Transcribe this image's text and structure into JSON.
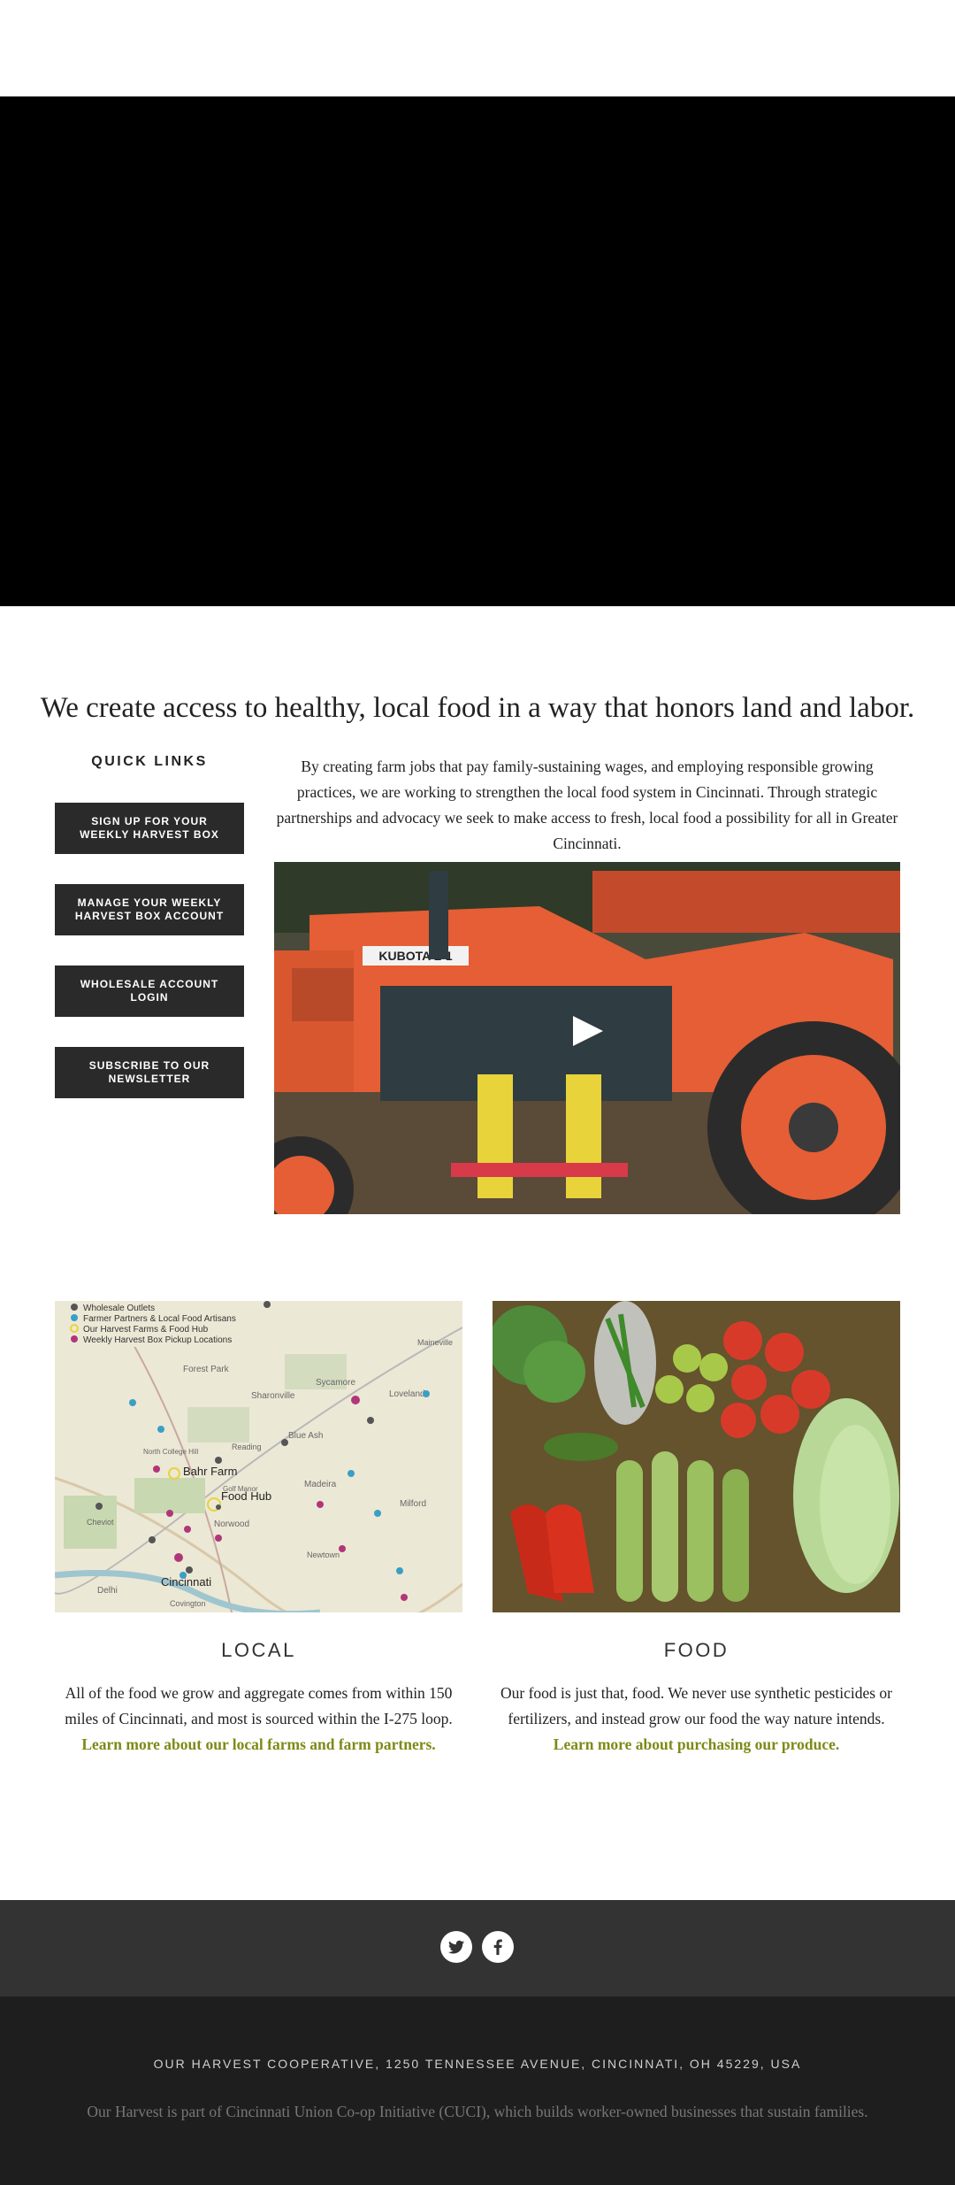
{
  "hero": {
    "background": "#000000"
  },
  "headline": "We create access to healthy, local food in a way that honors land and labor.",
  "quick_links": {
    "title": "QUICK LINKS",
    "buttons": [
      "SIGN UP FOR YOUR WEEKLY HARVEST BOX",
      "MANAGE YOUR WEEKLY HARVEST BOX ACCOUNT",
      "WHOLESALE ACCOUNT LOGIN",
      "SUBSCRIBE TO OUR NEWSLETTER"
    ]
  },
  "intro_text": "By creating farm jobs that pay family-sustaining wages, and employing responsible growing practices, we are working to strengthen the local food system in Cincinnati. Through strategic partnerships and advocacy we seek to make access to fresh, local food a possibility for all in Greater Cincinnati.",
  "video": {
    "tractor_label": "KUBOTA L-1"
  },
  "map": {
    "legend": [
      {
        "label": "Wholesale Outlets",
        "color": "#555555"
      },
      {
        "label": "Farmer Partners & Local Food Artisans",
        "color": "#3a9fc4"
      },
      {
        "label": "Our Harvest Farms & Food Hub",
        "color": "#e8d33a"
      },
      {
        "label": "Weekly Harvest Box Pickup Locations",
        "color": "#b0367a"
      }
    ],
    "places": [
      "Forest Park",
      "Sharonville",
      "Sycamore",
      "Loveland",
      "Blue Ash",
      "Reading",
      "Bahr Farm",
      "Food Hub",
      "Madeira",
      "Milford",
      "Norwood",
      "Newtown",
      "Cincinnati",
      "Covington",
      "Delhi",
      "Cheviot",
      "North College Hill",
      "Maineville",
      "Golf Manor"
    ]
  },
  "local": {
    "title": "LOCAL",
    "text": "All of the food we grow and aggregate comes from within 150 miles of Cincinnati, and most is sourced within the I-275 loop.",
    "link": "Learn more about our local farms and farm partners."
  },
  "food": {
    "title": "FOOD",
    "text": "Our food is just that, food. We never use synthetic pesticides or fertilizers, and instead grow our food the way nature intends.",
    "link": "Learn more about purchasing our produce."
  },
  "social": [
    "twitter",
    "facebook"
  ],
  "footer": {
    "address": "OUR HARVEST COOPERATIVE, 1250 TENNESSEE AVENUE, CINCINNATI, OH 45229, USA",
    "note": "Our Harvest is part of Cincinnati Union Co-op Initiative (CUCI), which builds worker-owned businesses that sustain families."
  },
  "colors": {
    "accent_link": "#7d8a16",
    "button_bg": "#2a2a2a",
    "social_bar": "#333333",
    "footer_bg": "#1e1e1e"
  }
}
